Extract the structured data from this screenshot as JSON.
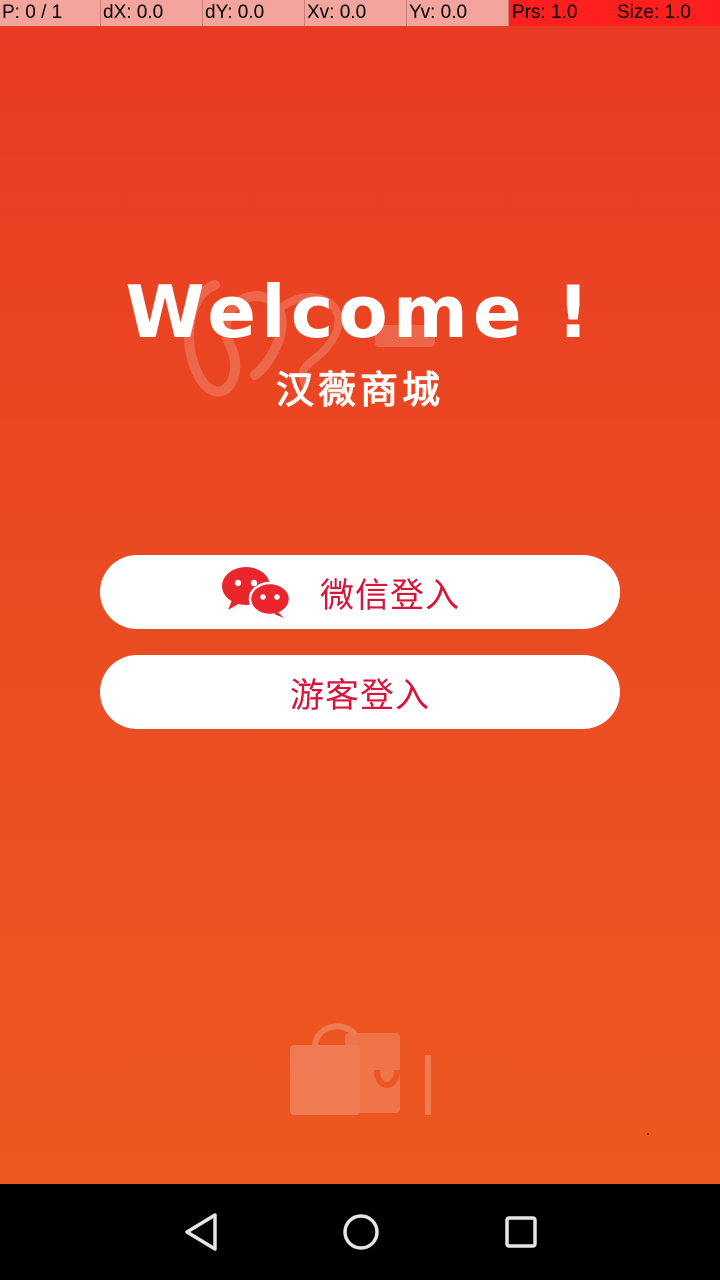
{
  "debug": {
    "pointer": "P: 0 / 1",
    "dx": "dX: 0.0",
    "dy": "dY: 0.0",
    "xv": "Xv: 0.0",
    "yv": "Yv: 0.0",
    "prs": "Prs: 1.0",
    "size": "Size: 1.0"
  },
  "login": {
    "welcome": "Welcome !",
    "brand": "汉薇商城",
    "wechat_button": {
      "label": "微信登入",
      "icon": "wechat-icon"
    },
    "guest_button": {
      "label": "游客登入"
    }
  },
  "navbar": {
    "back_icon": "back-triangle-icon",
    "home_icon": "home-circle-icon",
    "recent_icon": "recent-square-icon"
  },
  "colors": {
    "background_top": "#e93a23",
    "background_bottom": "#ec5820",
    "button_text": "#d7153a",
    "wechat_icon": "#e8262c"
  }
}
